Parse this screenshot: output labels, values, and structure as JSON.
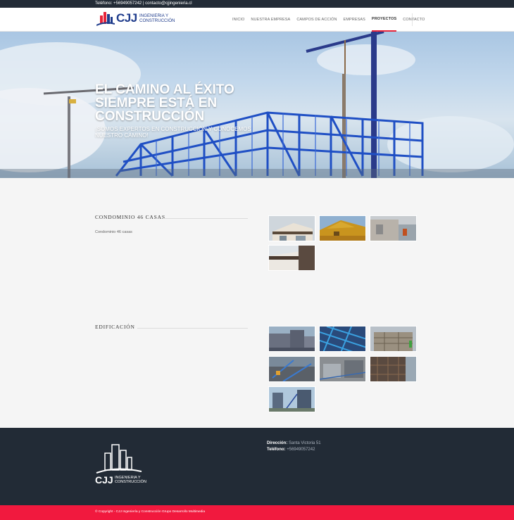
{
  "topbar": {
    "phone_label": "Teléfono:",
    "phone": "+56949057242",
    "separator": " | ",
    "email": "contacto@cjjingenieria.cl"
  },
  "header": {
    "logo_text": "CJJ",
    "logo_subtitle_line1": "INGENIERIA Y",
    "logo_subtitle_line2": "CONSTRUCCIÓN",
    "nav": [
      {
        "label": "INICIO",
        "active": false
      },
      {
        "label": "NUESTRA EMPRESA",
        "active": false
      },
      {
        "label": "CAMPOS DE ACCIÓN",
        "active": false
      },
      {
        "label": "EMPRESAS",
        "active": false
      },
      {
        "label": "PROYECTOS",
        "active": true
      },
      {
        "label": "CONTACTO",
        "active": false
      }
    ]
  },
  "hero": {
    "title": "EL CAMINO AL ÉXITO SIEMPRE ESTÁ EN CONSTRUCCIÓN",
    "subtitle": "¡SOMOS EXPERTOS EN CONSTRUCCIÓN Y CONOCEMOS NUESTRO CAMINO!"
  },
  "projects": [
    {
      "title": "CONDOMINIO 46 CASAS",
      "description": "Condominio 46 casas",
      "thumbnails": [
        "house-photo",
        "house-photo",
        "house-photo",
        "house-photo"
      ]
    },
    {
      "title": "EDIFICACIÓN",
      "description": "",
      "thumbnails": [
        "construction-photo",
        "construction-photo",
        "construction-photo",
        "construction-photo",
        "construction-photo",
        "construction-photo",
        "construction-photo"
      ]
    }
  ],
  "footer": {
    "logo_text": "CJJ",
    "logo_subtitle_line1": "INGENIERIA Y",
    "logo_subtitle_line2": "CONSTRUCCIÓN",
    "address_label": "Dirección:",
    "address": "Santa Victoria 51",
    "phone_label": "Teléfono:",
    "phone": "+56949057242",
    "copyright": "© Copyright - CJJ Ingeniería y Construcción Grupo Desarrollo Multimedia"
  },
  "colors": {
    "dark": "#222b36",
    "accent": "#f1193e",
    "brand_blue": "#1f3c8c"
  }
}
